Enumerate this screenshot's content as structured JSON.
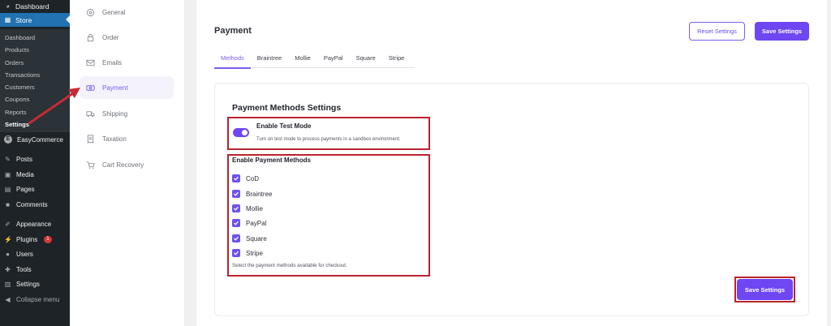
{
  "wp_sidebar": {
    "dashboard": "Dashboard",
    "store": "Store",
    "store_sub": [
      "Dashboard",
      "Products",
      "Orders",
      "Transactions",
      "Customers",
      "Coupons",
      "Reports",
      "Settings"
    ],
    "easycommerce": "EasyCommerce",
    "posts": "Posts",
    "media": "Media",
    "pages": "Pages",
    "comments": "Comments",
    "appearance": "Appearance",
    "plugins": "Plugins",
    "plugins_badge": "1",
    "users": "Users",
    "tools": "Tools",
    "settings": "Settings",
    "collapse": "Collapse menu"
  },
  "settings_nav": {
    "items": [
      {
        "label": "General",
        "icon": "gear-icon"
      },
      {
        "label": "Order",
        "icon": "lock-icon"
      },
      {
        "label": "Emails",
        "icon": "envelope-icon"
      },
      {
        "label": "Payment",
        "icon": "money-icon"
      },
      {
        "label": "Shipping",
        "icon": "truck-icon"
      },
      {
        "label": "Taxation",
        "icon": "receipt-icon"
      },
      {
        "label": "Cart Recovery",
        "icon": "cart-icon"
      }
    ],
    "active": "Payment"
  },
  "header": {
    "title": "Payment",
    "reset_label": "Reset Settings",
    "save_label": "Save Settings"
  },
  "tabs": [
    "Methods",
    "Braintree",
    "Mollie",
    "PayPal",
    "Square",
    "Stripe"
  ],
  "active_tab": "Methods",
  "card": {
    "title": "Payment Methods Settings",
    "test_mode": {
      "label": "Enable Test Mode",
      "description": "Turn on test mode to process payments in a sandbox environment.",
      "enabled": true
    },
    "methods_title": "Enable Payment Methods",
    "methods": [
      {
        "label": "CoD",
        "checked": true
      },
      {
        "label": "Braintree",
        "checked": true
      },
      {
        "label": "Mollie",
        "checked": true
      },
      {
        "label": "PayPal",
        "checked": true
      },
      {
        "label": "Square",
        "checked": true
      },
      {
        "label": "Stripe",
        "checked": true
      }
    ],
    "methods_help": "Select the payment methods available for checkout.",
    "save_label": "Save Settings"
  },
  "colors": {
    "accent": "#6e46f2",
    "wp_sidebar": "#1d2327",
    "wp_current": "#2271b1",
    "highlight": "#b9242f"
  }
}
